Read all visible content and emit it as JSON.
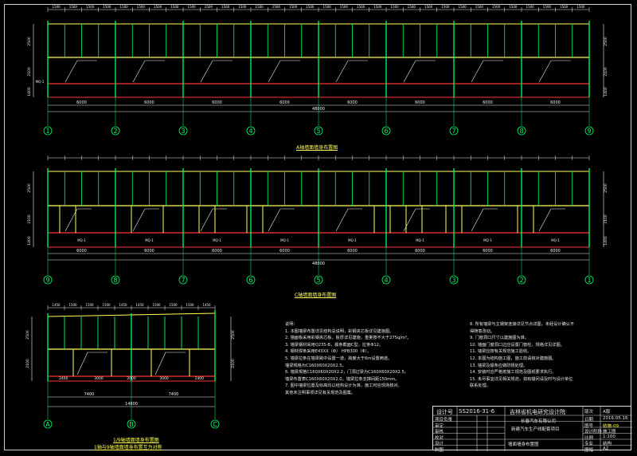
{
  "drawing": {
    "elevation_a": {
      "title": "A轴墙面墙身布置图",
      "top_dims": [
        "1500",
        "1500",
        "1500",
        "1500",
        "1500",
        "1500",
        "1500",
        "1500",
        "1500",
        "1500",
        "1500",
        "1500",
        "1500",
        "1500",
        "1500",
        "1500",
        "1500",
        "1500",
        "1500",
        "1500",
        "1500",
        "1500",
        "1500",
        "1500",
        "1500",
        "1500",
        "1500",
        "1500",
        "1500",
        "1500",
        "1500",
        "1500"
      ],
      "bay_dims": [
        "6000",
        "6000",
        "6000",
        "6000",
        "6000",
        "6000",
        "6000",
        "6000"
      ],
      "total_dim": "48000",
      "grid_labels": [
        "1",
        "2",
        "3",
        "4",
        "5",
        "6",
        "7",
        "8",
        "9"
      ],
      "side_dims": [
        "2500",
        "2100",
        "1400"
      ],
      "side_marks": [
        "MQ-1"
      ]
    },
    "elevation_c": {
      "title": "C轴墙面墙身布置图",
      "bay_dims": [
        "6000",
        "6000",
        "6000",
        "6000",
        "6000",
        "6000",
        "6000",
        "6000"
      ],
      "total_dim": "48000",
      "grid_labels": [
        "9",
        "8",
        "7",
        "6",
        "5",
        "4",
        "3",
        "2",
        "1"
      ],
      "door_marks": [
        "MQ-1",
        "MQ-1",
        "MQ-1",
        "MQ-1",
        "MQ-1",
        "MQ-1",
        "MQ-1",
        "MQ-1"
      ],
      "side_dims": [
        "2500",
        "2100",
        "1400"
      ]
    },
    "elevation_side": {
      "title": "1/9轴墙面墙身布置图",
      "subtitle": "1轴与9轴墙面墙身布置互为对称",
      "top_dims": [
        "1450",
        "1500",
        "1500",
        "1500",
        "1450",
        "1450",
        "1500",
        "1500",
        "1500",
        "1450"
      ],
      "lower_dims": [
        "2400",
        "3000",
        "2000",
        "3000",
        "2400"
      ],
      "half_dims": [
        "7400",
        "7400"
      ],
      "total_dim": "14800",
      "grid_labels": [
        "A",
        "B",
        "C"
      ]
    },
    "notes_title": "说明：",
    "notes": [
      "1. 本图墙梁布置详见结构总说明，彩钢夹芯板详见建施图。",
      "2. 墙面板采用彩钢夹芯板，板厚详见建施，重量按不大于275q/m²。",
      "3. 墙梁钢材采用Q235-B，檩条截面C型，拉条Φ12。",
      "4. 钢材焊条采用E43XX（Φ） HPB300（Φ）。",
      "5. 墙梁拉条在墙梁跨中设置一道，跨度大于6m设置两道。",
      "   墙梁规格为C160X60X20X2.5。",
      "6. 墙梁规格C160X60X20X2.2，门洞过梁为C160X60X20X2.5。",
      "   墙梁布置表C160X60X20X2.0，墙梁拉条支撑间距150mm。",
      "7. 图中墙梁位置及标高均以结构设计为准，施工时应现场核对。",
      "   其他未注明事项详见有关规范及图集。"
    ],
    "notes_right": [
      "8. 所有墙梁与主钢架连接详见节点详图，未经设计确认不",
      "   得随意改动。",
      "9. 门窗洞口尺寸以建施图为准。",
      "10. 墙面门窗洞口边应设置门窗柱，规格详见详图。",
      "11. 墙梁应按有关规范施工验收。",
      "12. 本图为结构施工图，施工前请核对建施图。",
      "13. 墙梁及檩条应做防锈处理。",
      "14. 安装时应严格按施工规范及图纸要求执行。",
      "15. 未尽事宜详见相关规范，如有疑问请及时与设计单位",
      "   联系处理。"
    ],
    "title_block": {
      "design_no_label": "设计号",
      "design_no": "SS2016-31-6",
      "institute": "吉林省机电研究设计院",
      "client": "长春汽车有限公司",
      "project": "新建汽车生产线配套项目",
      "drawing_name": "墙面墙身布置图",
      "rows": [
        "项目负责",
        "审定",
        "审核",
        "校对",
        "设计",
        "制图"
      ],
      "right_labels": [
        "版次",
        "日期",
        "图号",
        "设计阶段",
        "比例",
        "专业",
        "图幅"
      ],
      "right_values": [
        "A版",
        "2016.05.16",
        "结施-09",
        "施工图",
        "1:100",
        "结构",
        "A2"
      ]
    }
  }
}
